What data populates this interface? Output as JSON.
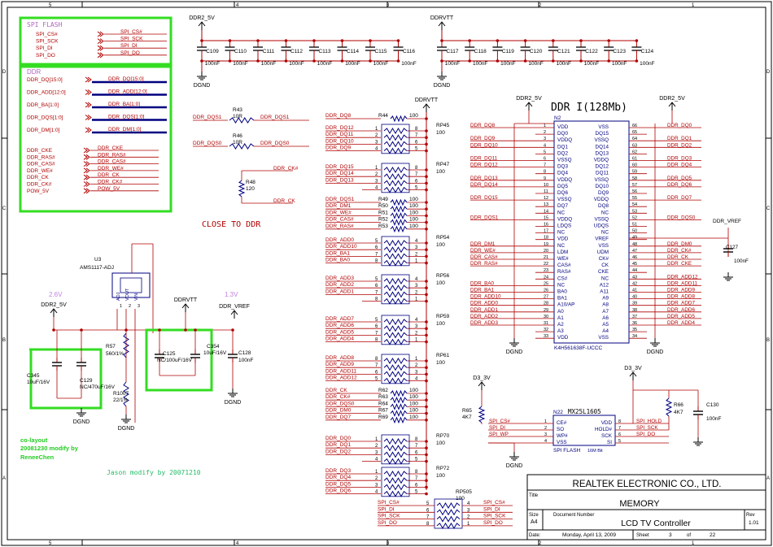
{
  "border": {
    "cols": [
      "5",
      "4",
      "3",
      "2",
      "1"
    ],
    "rows": [
      "D",
      "C",
      "B",
      "A"
    ]
  },
  "flash_box": {
    "title": "SPI FLASH",
    "in": [
      "SPI_CS#",
      "SPI_SCK",
      "SPI_DI",
      "SPI_DO"
    ],
    "out": [
      "SPI_CS#",
      "SPI_SCK",
      "SPI_DI",
      "SPI_DO"
    ]
  },
  "ddr_box": {
    "title": "DDR",
    "bus_in": [
      "DDR_DQ[15:0]",
      "DDR_ADD[12:0]",
      "DDR_BA[1:0]",
      "DDR_DQS[1:0]",
      "DDR_DM[1:0]"
    ],
    "bus_out": [
      "DDR_DQ[15:0]",
      "DDR_ADD[12:0]",
      "DDR_BA[1:0]",
      "DDR_DQS[1:0]",
      "DDR_DM[1:0]"
    ],
    "sig_in": [
      "DDR_CKE",
      "DDR_RAS#",
      "DDR_CAS#",
      "DDR_WE#",
      "DDR_CK",
      "DDR_CK#",
      "POW_5V"
    ],
    "sig_out": [
      "DDR_CKE",
      "DDR_RAS#",
      "DDR_CAS#",
      "DDR_WE#",
      "DDR_CK",
      "DDR_CK#",
      "POW_5V"
    ]
  },
  "cap_bank1": {
    "rail": "DDR2_5V",
    "gnd": "DGND",
    "refs": [
      "C109",
      "C110",
      "C111",
      "C112",
      "C113",
      "C114",
      "C115",
      "C116"
    ],
    "value": "100nF"
  },
  "cap_bank2": {
    "rail": "DDRVTT",
    "gnd": "DGND",
    "refs": [
      "C117",
      "C118",
      "C119",
      "C120",
      "C121",
      "C122",
      "C123",
      "C124"
    ],
    "value": "100nF"
  },
  "dqs_res": {
    "r43": "R43",
    "r43v": "10R",
    "r43l": "DDR_DQS1",
    "r43r": "DDR_DQS1",
    "r46": "R46",
    "r46v": "10R",
    "r46l": "DDR_DQS0",
    "r46r": "DDR_DQS0",
    "r48": "R48",
    "r48v": "120",
    "ck": "DDR_CK#",
    "ck2": "DDR_CK"
  },
  "close_note": "CLOSE TO DDR",
  "term": {
    "rail": "DDRVTT",
    "r44": "R44",
    "r44v": "100",
    "r44n": "DDR_DQ8",
    "rp45": "RP45",
    "rp45v": "100",
    "rp45n": [
      "DDR_DQ12",
      "DDR_DQ11",
      "DDR_DQ10",
      "DDR_DQ9"
    ],
    "rp45p": [
      "1",
      "2",
      "3",
      "4",
      "8",
      "7",
      "6",
      "5"
    ],
    "rp47": "RP47",
    "rp47v": "100",
    "rp47n": [
      "DDR_DQ15",
      "DDR_DQ14",
      "DDR_DQ13"
    ],
    "rp47p": [
      "1",
      "2",
      "3",
      "4",
      "8",
      "7",
      "6",
      "5"
    ],
    "singles": [
      {
        "n": "DDR_DQS1",
        "r": "R49",
        "v": "100"
      },
      {
        "n": "DDR_DM1",
        "r": "R50",
        "v": "100"
      },
      {
        "n": "DDR_WE#",
        "r": "R51",
        "v": "100"
      },
      {
        "n": "DDR_CAS#",
        "r": "R52",
        "v": "100"
      },
      {
        "n": "DDR_RAS#",
        "r": "R53",
        "v": "100"
      }
    ],
    "rp54": "RP54",
    "rp54v": "100",
    "rp54n": [
      "DDR_ADD0",
      "DDR_ADD10",
      "DDR_BA1",
      "DDR_BA0"
    ],
    "rp54p": [
      "5",
      "6",
      "7",
      "8",
      "4",
      "3",
      "2",
      "1"
    ],
    "rp56": "RP56",
    "rp56v": "100",
    "rp56n": [
      "DDR_ADD3",
      "DDR_ADD2",
      "DDR_ADD1"
    ],
    "rp56p": [
      "5",
      "6",
      "7",
      "8",
      "4",
      "3",
      "2",
      "1"
    ],
    "rp59": "RP59",
    "rp59v": "100",
    "rp59n": [
      "DDR_ADD7",
      "DDR_ADD6",
      "DDR_ADD5",
      "DDR_ADD4"
    ],
    "rp59p": [
      "5",
      "6",
      "7",
      "8",
      "4",
      "3",
      "2",
      "1"
    ],
    "rp61": "RP61",
    "rp61v": "100",
    "rp61n": [
      "DDR_ADD8",
      "DDR_ADD9",
      "DDR_ADD11",
      "DDR_ADD12"
    ],
    "rp61p": [
      "8",
      "7",
      "6",
      "5",
      "1",
      "2",
      "3",
      "4"
    ],
    "singles2": [
      {
        "n": "DDR_CK",
        "r": "R62",
        "v": "100"
      },
      {
        "n": "DDR_CK#",
        "r": "R63",
        "v": "100"
      },
      {
        "n": "DDR_DQS0",
        "r": "R64",
        "v": "100"
      },
      {
        "n": "DDR_DM0",
        "r": "R67",
        "v": "100"
      },
      {
        "n": "DDR_DQ7",
        "r": "R69",
        "v": "100"
      }
    ],
    "rp70": "RP70",
    "rp70v": "100",
    "rp70n": [
      "DDR_DQ0",
      "DDR_DQ1",
      "DDR_DQ2"
    ],
    "rp70p": [
      "1",
      "2",
      "3",
      "4",
      "8",
      "7",
      "6",
      "5"
    ],
    "rp72": "RP72",
    "rp72v": "100",
    "rp72n": [
      "DDR_DQ3",
      "DDR_DQ4",
      "DDR_DQ5",
      "DDR_DQ6"
    ],
    "rp72p": [
      "1",
      "2",
      "3",
      "4",
      "8",
      "7",
      "6",
      "5"
    ]
  },
  "rp505": {
    "ref": "RP505",
    "val": "100",
    "left": [
      "SPI_CS#",
      "SPI_DI",
      "SPI_SCK",
      "SPI_DO"
    ],
    "right": [
      "SPI_CS#",
      "SPI_DI",
      "SPI_SCK",
      "SPI_DO"
    ],
    "lp": [
      "5",
      "6",
      "7",
      "8"
    ],
    "rp": [
      "4",
      "3",
      "2",
      "1"
    ]
  },
  "ddr_chip": {
    "title": "DDR I(128Mb)",
    "ref": "N2",
    "part": "K4H561638F-UCCC",
    "rail_l": "DDR2_5V",
    "rail_r": "DDR2_5V",
    "gnd": "DGND",
    "lnum": [
      "1",
      "2",
      "3",
      "4",
      "5",
      "6",
      "7",
      "8",
      "9",
      "10",
      "11",
      "12",
      "13",
      "14",
      "15",
      "16",
      "17",
      "18",
      "19",
      "20",
      "21",
      "22",
      "23",
      "24",
      "25",
      "26",
      "27",
      "28",
      "29",
      "30",
      "31",
      "32",
      "33"
    ],
    "lpin": [
      "VDD",
      "DQ0",
      "VDDQ",
      "DQ1",
      "DQ2",
      "VSSQ",
      "DQ3",
      "DQ4",
      "VDDQ",
      "DQ5",
      "DQ6",
      "VSSQ",
      "DQ7",
      "NC",
      "VDDQ",
      "LDQS",
      "NC",
      "VDD",
      "NC",
      "LDM",
      "WE#",
      "CAS#",
      "RAS#",
      "CS#",
      "NC",
      "BA0",
      "BA1",
      "A10/AP",
      "A0",
      "A1",
      "A2",
      "A3",
      "VDD"
    ],
    "rnum": [
      "66",
      "65",
      "64",
      "63",
      "62",
      "61",
      "60",
      "59",
      "58",
      "57",
      "56",
      "55",
      "54",
      "53",
      "52",
      "51",
      "50",
      "49",
      "48",
      "47",
      "46",
      "45",
      "44",
      "43",
      "42",
      "41",
      "40",
      "39",
      "38",
      "37",
      "36",
      "35",
      "34"
    ],
    "rpin": [
      "VSS",
      "DQ15",
      "VSSQ",
      "DQ14",
      "DQ13",
      "VDDQ",
      "DQ12",
      "DQ11",
      "VSSQ",
      "DQ10",
      "DQ9",
      "VDDQ",
      "DQ8",
      "NC",
      "VSSQ",
      "UDQS",
      "NC",
      "VREF",
      "VSS",
      "UDM",
      "CK#",
      "CK",
      "CKE",
      "NC",
      "A12",
      "A11",
      "A9",
      "A8",
      "A7",
      "A6",
      "A5",
      "A4",
      "VSS"
    ],
    "lnet": {
      "1": "DDR_DQ8",
      "3": "DDR_DQ9",
      "4": "DDR_DQ10",
      "6": "DDR_DQ11",
      "7": "DDR_DQ12",
      "9": "DDR_DQ13",
      "10": "DDR_DQ14",
      "12": "DDR_DQ15",
      "15": "DDR_DQS1",
      "19": "DDR_DM1",
      "20": "DDR_WE#",
      "21": "DDR_CAS#",
      "22": "DDR_RAS#",
      "25": "DDR_BA0",
      "26": "DDR_BA1",
      "27": "DDR_ADD10",
      "28": "DDR_ADD0",
      "29": "DDR_ADD1",
      "30": "DDR_ADD2",
      "31": "DDR_ADD3"
    },
    "rnet": {
      "1": "DDR_DQ0",
      "3": "DDR_DQ1",
      "4": "DDR_DQ2",
      "6": "DDR_DQ3",
      "7": "DDR_DQ4",
      "9": "DDR_DQ5",
      "10": "DDR_DQ6",
      "12": "DDR_DQ7",
      "15": "DDR_DQS0",
      "19": "DDR_DM0",
      "20": "DDR_CK#",
      "21": "DDR_CK",
      "22": "DDR_CKE",
      "24": "DDR_ADD12",
      "25": "DDR_ADD11",
      "26": "DDR_ADD9",
      "27": "DDR_ADD8",
      "28": "DDR_ADD7",
      "29": "DDR_ADD6",
      "30": "DDR_ADD5",
      "31": "DDR_ADD4"
    },
    "vref": "DDR_VREF",
    "c127": "C127",
    "c127v": "100nF"
  },
  "reg": {
    "ref": "U3",
    "part": "AMS1117-ADJ",
    "pins": [
      "ADJ",
      "VOUT",
      "VIN"
    ],
    "pinnum": [
      "1",
      "2",
      "3"
    ],
    "v26": "2.6V",
    "v13": "1.3V",
    "rail": "DDR2_5V",
    "vtt": "DDRVTT",
    "vref": "DDR_VREF",
    "gnd": "DGND",
    "c345": "C345",
    "c345v": "10uF/16V",
    "c129": "C129",
    "c129v": "NC/470uF/16V",
    "r57": "R57",
    "r57v": "560/1%",
    "r1007": "R1007",
    "r1007v": "22/1%",
    "c125": "C125",
    "c125v": "NC/100uF/16V",
    "c354": "C354",
    "c354v": "10uF/16V",
    "c128": "C128",
    "c128v": "100nF"
  },
  "note": {
    "l1": "co-layout",
    "l2": "20081230 modify by",
    "l3": "ReneeChen",
    "jason": "Jason modify by 20071210"
  },
  "flash": {
    "ref": "N22",
    "part": "MX25L1605",
    "size": "16M Bit",
    "label": "SPI FLASH",
    "rail": "D3_3V",
    "gnd": "DGND",
    "lpin": [
      "CE#",
      "SO",
      "WP#",
      "VSS"
    ],
    "lnum": [
      "1",
      "2",
      "3",
      "4"
    ],
    "rpin": [
      "VDD",
      "HOLD#",
      "SCK",
      "SI"
    ],
    "rnum": [
      "8",
      "7",
      "6",
      "5"
    ],
    "lnet": [
      "SPI_CS#",
      "SPI_DI",
      "SPI_WP"
    ],
    "rnet": [
      "SPI_HOLD",
      "SPI_SCK",
      "SPI_DO"
    ],
    "r65": "R65",
    "r65v": "4K7",
    "r66": "R66",
    "r66v": "4K7",
    "c130": "C130",
    "c130v": "100nF"
  },
  "title_block": {
    "company": "REALTEK ELECTRONIC CO., LTD.",
    "title_lbl": "Title",
    "title": "MEMORY",
    "size_lbl": "Size",
    "size": "A4",
    "docnum_lbl": "Document Number",
    "doc": "LCD TV Controller",
    "rev_lbl": "Rev",
    "rev": "1.01",
    "date_lbl": "Date:",
    "date": "Monday, April 13, 2009",
    "sheet_lbl": "Sheet",
    "sheet": "3",
    "of_lbl": "of",
    "of": "22"
  }
}
